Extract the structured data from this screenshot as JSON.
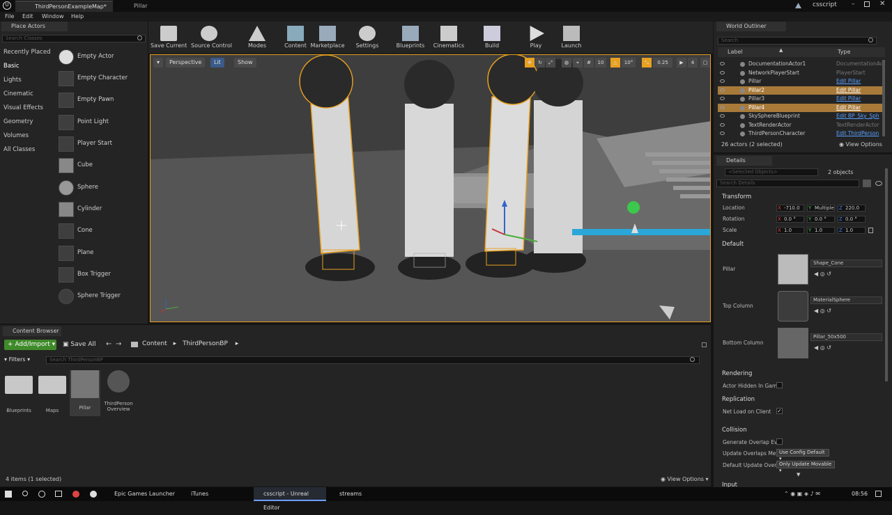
{
  "title_bar": {
    "tabs": [
      {
        "label": "ThirdPersonExampleMap*"
      },
      {
        "label": "Pillar"
      }
    ],
    "project": "csscript"
  },
  "menu": [
    "File",
    "Edit",
    "Window",
    "Help"
  ],
  "place_actors": {
    "tab": "Place Actors",
    "search_placeholder": "Search Classes",
    "categories": [
      "Recently Placed",
      "Basic",
      "Lights",
      "Cinematic",
      "Visual Effects",
      "Geometry",
      "Volumes",
      "All Classes"
    ],
    "items": [
      "Empty Actor",
      "Empty Character",
      "Empty Pawn",
      "Point Light",
      "Player Start",
      "Cube",
      "Sphere",
      "Cylinder",
      "Cone",
      "Plane",
      "Box Trigger",
      "Sphere Trigger"
    ]
  },
  "toolbar": [
    "Save Current",
    "Source Control",
    "Modes",
    "Content",
    "Marketplace",
    "Settings",
    "Blueprints",
    "Cinematics",
    "Build",
    "Play",
    "Launch"
  ],
  "viewport": {
    "perspective": "Perspective",
    "lit": "Lit",
    "show": "Show",
    "grid_snap": "10",
    "rot_snap": "10°",
    "scale_snap": "0.25",
    "camera_speed": "4"
  },
  "outliner": {
    "tab": "World Outliner",
    "search_placeholder": "Search",
    "col_label": "Label",
    "col_type": "Type",
    "rows": [
      {
        "name": "DocumentationActor1",
        "type": "DocumentationAc",
        "link": false,
        "selected": false
      },
      {
        "name": "NetworkPlayerStart",
        "type": "PlayerStart",
        "link": false,
        "selected": false
      },
      {
        "name": "Pillar",
        "type": "Edit Pillar",
        "link": true,
        "selected": false
      },
      {
        "name": "Pillar2",
        "type": "Edit Pillar",
        "link": true,
        "selected": true
      },
      {
        "name": "Pillar3",
        "type": "Edit Pillar",
        "link": true,
        "selected": false
      },
      {
        "name": "Pillar4",
        "type": "Edit Pillar",
        "link": true,
        "selected": true
      },
      {
        "name": "SkySphereBlueprint",
        "type": "Edit BP_Sky_Sph",
        "link": true,
        "selected": false
      },
      {
        "name": "TextRenderActor",
        "type": "TextRenderActor",
        "link": false,
        "selected": false
      },
      {
        "name": "ThirdPersonCharacter",
        "type": "Edit ThirdPerson",
        "link": true,
        "selected": false
      }
    ],
    "status": "26 actors (2 selected)",
    "view_options": "View Options"
  },
  "details": {
    "tab": "Details",
    "selected_objects": "<Selected Objects>",
    "count": "2 objects",
    "search_placeholder": "Search Details",
    "transform_title": "Transform",
    "location_label": "Location",
    "location": {
      "x": "-710.0",
      "y": "Multiple",
      "z": "220.0"
    },
    "rotation_label": "Rotation",
    "rotation": {
      "x": "0.0 °",
      "y": "0.0 °",
      "z": "0.0 °"
    },
    "scale_label": "Scale",
    "scale": {
      "x": "1.0",
      "y": "1.0",
      "z": "1.0"
    },
    "default_title": "Default",
    "assets": [
      {
        "label": "Pillar",
        "value": "Shape_Cone"
      },
      {
        "label": "Top Column",
        "value": "MaterialSphere"
      },
      {
        "label": "Bottom Column",
        "value": "Pillar_50x500"
      }
    ],
    "rendering_title": "Rendering",
    "actor_hidden": "Actor Hidden In Game",
    "replication_title": "Replication",
    "net_load": "Net Load on Client",
    "collision_title": "Collision",
    "gen_overlap": "Generate Overlap Ever",
    "update_overlaps": "Update Overlaps Meth",
    "update_overlaps_value": "Use Config Default",
    "default_update": "Default Update Overla",
    "default_update_value": "Only Update Movable",
    "input_title": "Input"
  },
  "content_browser": {
    "tab": "Content Browser",
    "add_import": "Add/Import",
    "save_all": "Save All",
    "crumbs": [
      "Content",
      "ThirdPersonBP"
    ],
    "filters": "Filters",
    "search_placeholder": "Search ThirdPersonBP",
    "items": [
      {
        "label": "Blueprints"
      },
      {
        "label": "Maps"
      },
      {
        "label": "Pillar"
      },
      {
        "label": "ThirdPerson Overview"
      }
    ],
    "status": "4 items (1 selected)",
    "view_options": "View Options"
  },
  "taskbar": {
    "items": [
      "Epic Games Launcher",
      "iTunes",
      "csscript - Unreal Editor",
      "streams"
    ],
    "time": "08:56"
  },
  "colors": {
    "selection": "#e8a020",
    "link": "#5aa0ff",
    "add_button": "#3f8a2a"
  }
}
